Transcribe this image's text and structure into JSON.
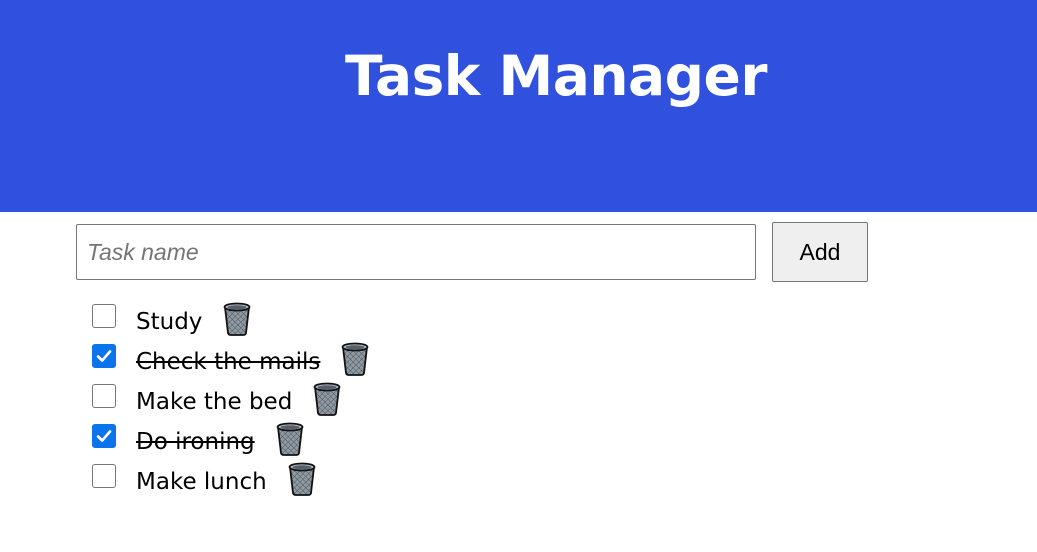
{
  "header": {
    "title": "Task Manager",
    "background_color": "#3050de"
  },
  "form": {
    "input_placeholder": "Task name",
    "input_value": "",
    "add_label": "Add"
  },
  "tasks": [
    {
      "label": "Study",
      "completed": false,
      "delete_icon": "trash-can-icon"
    },
    {
      "label": "Check the mails",
      "completed": true,
      "delete_icon": "trash-can-icon"
    },
    {
      "label": "Make the bed",
      "completed": false,
      "delete_icon": "trash-can-icon"
    },
    {
      "label": "Do ironing",
      "completed": true,
      "delete_icon": "trash-can-icon"
    },
    {
      "label": "Make lunch",
      "completed": false,
      "delete_icon": "trash-can-icon"
    }
  ],
  "colors": {
    "checkbox_checked": "#0b73ec"
  }
}
